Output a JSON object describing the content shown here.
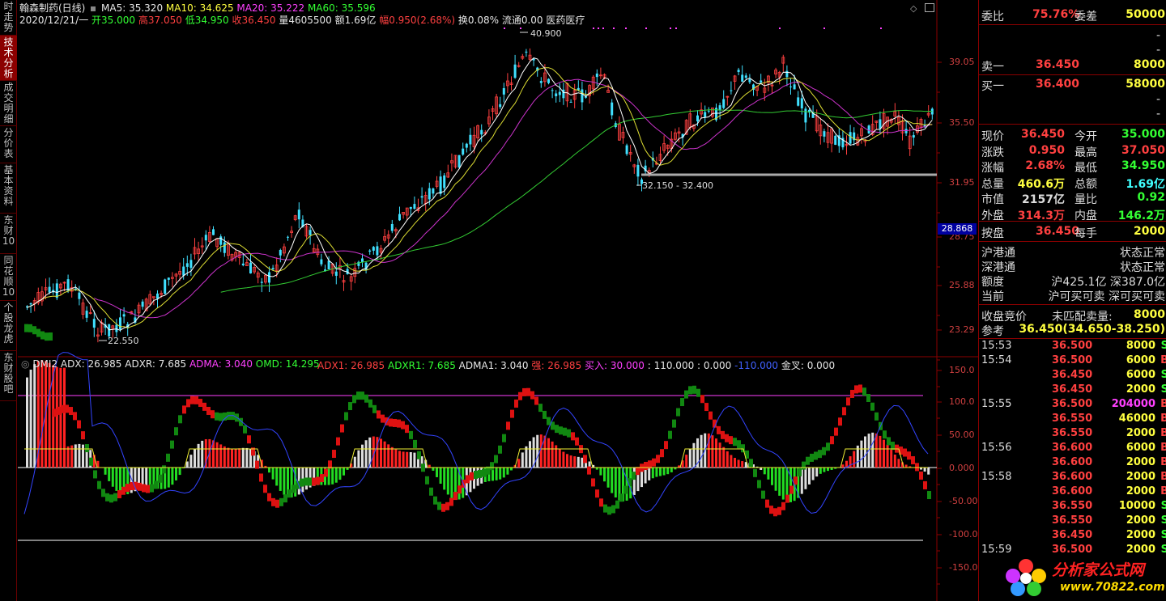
{
  "left_tabs": [
    "时走势",
    "技术分析",
    "成交明细",
    "分价表",
    "基本资料",
    "东财10",
    "同花顺10",
    "个股龙虎",
    "东财股吧"
  ],
  "header": {
    "stock": "翰森制药(日线)",
    "ma5": "MA5: 35.320",
    "ma10": "MA10: 34.625",
    "ma20": "MA20: 35.222",
    "ma60": "MA60: 35.596",
    "date": "2020/12/21/一",
    "open": "开35.000",
    "high": "高37.050",
    "low": "低34.950",
    "close": "收36.450",
    "vol": "量4605500",
    "amt": "额1.69亿",
    "range": "幅0.950(2.68%)",
    "turn": "换0.08%",
    "float": "流通0.00",
    "sector": "医药医疗"
  },
  "price_axis": [
    "39.05",
    "35.50",
    "31.95",
    "28.75",
    "25.88",
    "23.29"
  ],
  "price_highlight": "28.868",
  "price_annotations": {
    "high": "40.900",
    "range": "32.150 - 32.400",
    "low": "22.550"
  },
  "dmi_header": {
    "name": "DMI2",
    "adx": "ADX: 26.985",
    "adxr": "ADXR: 7.685",
    "adma": "ADMA: 3.040",
    "omd": "OMD: 14.295",
    "adx1": "ADX1: 26.985",
    "adxr1": "ADXR1: 7.685",
    "adma1": "ADMA1: 3.040",
    "strong": "强: 26.985",
    "buy": "买入: 30.000",
    "v110": ": 110.000",
    "v0": ": 0.000",
    "vneg": "-110.000",
    "golden": "金叉: 0.000"
  },
  "dmi_axis": [
    "150.0",
    "100.0",
    "50.00",
    "0.000",
    "-50.00",
    "-100.0",
    "-150.0"
  ],
  "order_book": {
    "wb_label": "委比",
    "wb": "75.76%",
    "wc_label": "委差",
    "wc": "50000",
    "sell1_label": "卖一",
    "sell1_price": "36.450",
    "sell1_vol": "8000",
    "buy1_label": "买一",
    "buy1_price": "36.400",
    "buy1_vol": "58000",
    "dash": "-"
  },
  "quote": [
    {
      "l1": "现价",
      "v1": "36.450",
      "l2": "今开",
      "v2": "35.000"
    },
    {
      "l1": "涨跌",
      "v1": "0.950",
      "l2": "最高",
      "v2": "37.050"
    },
    {
      "l1": "涨幅",
      "v1": "2.68%",
      "l2": "最低",
      "v2": "34.950"
    },
    {
      "l1": "总量",
      "v1": "460.6万",
      "l2": "总额",
      "v2": "1.69亿"
    },
    {
      "l1": "市值",
      "v1": "2157亿",
      "l2": "量比",
      "v2": "0.92"
    },
    {
      "l1": "外盘",
      "v1": "314.3万",
      "l2": "内盘",
      "v2": "146.2万"
    }
  ],
  "pan": {
    "l1": "按盘",
    "v1": "36.450",
    "l2": "每手",
    "v2": "2000"
  },
  "connect": {
    "hk_sh": "沪港通",
    "hk_sh_s": "状态正常",
    "hk_sz": "深港通",
    "hk_sz_s": "状态正常",
    "quota": "额度",
    "quota_v": "沪425.1亿 深387.0亿",
    "now": "当前",
    "now_v": "沪可买可卖 深可买可卖"
  },
  "auction": {
    "l1": "收盘竞价",
    "v1": "未匹配卖量:",
    "v1b": "8000",
    "l2": "参考",
    "v2": "36.450(34.650-38.250)"
  },
  "ticks": [
    {
      "t": "15:53",
      "p": "36.500",
      "v": "8000",
      "s": "S"
    },
    {
      "t": "15:54",
      "p": "36.500",
      "v": "6000",
      "s": "B"
    },
    {
      "t": "",
      "p": "36.450",
      "v": "6000",
      "s": "S"
    },
    {
      "t": "",
      "p": "36.450",
      "v": "2000",
      "s": "S"
    },
    {
      "t": "15:55",
      "p": "36.500",
      "v": "204000",
      "s": "B"
    },
    {
      "t": "",
      "p": "36.550",
      "v": "46000",
      "s": "B"
    },
    {
      "t": "",
      "p": "36.550",
      "v": "2000",
      "s": "B"
    },
    {
      "t": "15:56",
      "p": "36.600",
      "v": "6000",
      "s": "B"
    },
    {
      "t": "",
      "p": "36.600",
      "v": "2000",
      "s": "B"
    },
    {
      "t": "15:58",
      "p": "36.600",
      "v": "2000",
      "s": "B"
    },
    {
      "t": "",
      "p": "36.600",
      "v": "2000",
      "s": "B"
    },
    {
      "t": "",
      "p": "36.550",
      "v": "10000",
      "s": "S"
    },
    {
      "t": "",
      "p": "36.550",
      "v": "2000",
      "s": "S"
    },
    {
      "t": "",
      "p": "36.450",
      "v": "2000",
      "s": "S"
    },
    {
      "t": "15:59",
      "p": "36.500",
      "v": "2000",
      "s": "S"
    }
  ],
  "watermark": {
    "text": "分析家公式网",
    "url": "www.70822.com"
  },
  "colors": {
    "up": "#ff4040",
    "down": "#40ffff",
    "ma5": "#ffffff",
    "ma10": "#ffff40",
    "ma20": "#ff40ff",
    "ma60": "#33ff33",
    "border": "#8b0000"
  }
}
